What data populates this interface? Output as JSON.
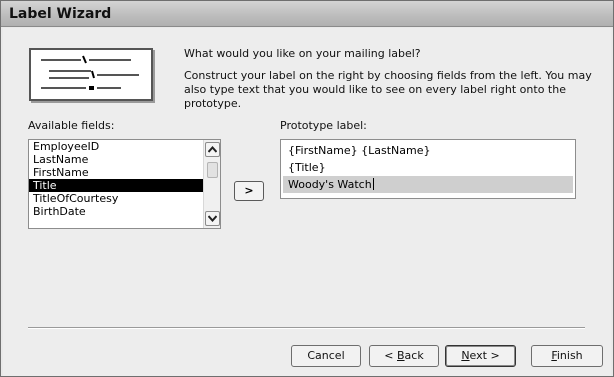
{
  "window": {
    "title": "Label Wizard"
  },
  "intro": {
    "question": "What would you like on your mailing label?",
    "instructions": "Construct your label on the right by choosing fields from the left. You may also type text that you would like to see on every label right onto the prototype."
  },
  "available_fields": {
    "caption": "Available fields:",
    "items": [
      "EmployeeID",
      "LastName",
      "FirstName",
      "Title",
      "TitleOfCourtesy",
      "BirthDate"
    ],
    "selected": "Title"
  },
  "add_button": {
    "label": ">"
  },
  "prototype": {
    "caption": "Prototype label:",
    "lines": [
      "{FirstName} {LastName}",
      "{Title}",
      "Woody's Watch"
    ]
  },
  "buttons": {
    "cancel": "Cancel",
    "back_prefix": "< ",
    "back_accel": "B",
    "back_rest": "ack",
    "next_accel": "N",
    "next_rest": "ext >",
    "finish_accel": "F",
    "finish_rest": "inish"
  },
  "icons": {
    "label_preview": "label-preview-icon",
    "scroll_up": "chevron-up-icon",
    "scroll_down": "chevron-down-icon"
  }
}
